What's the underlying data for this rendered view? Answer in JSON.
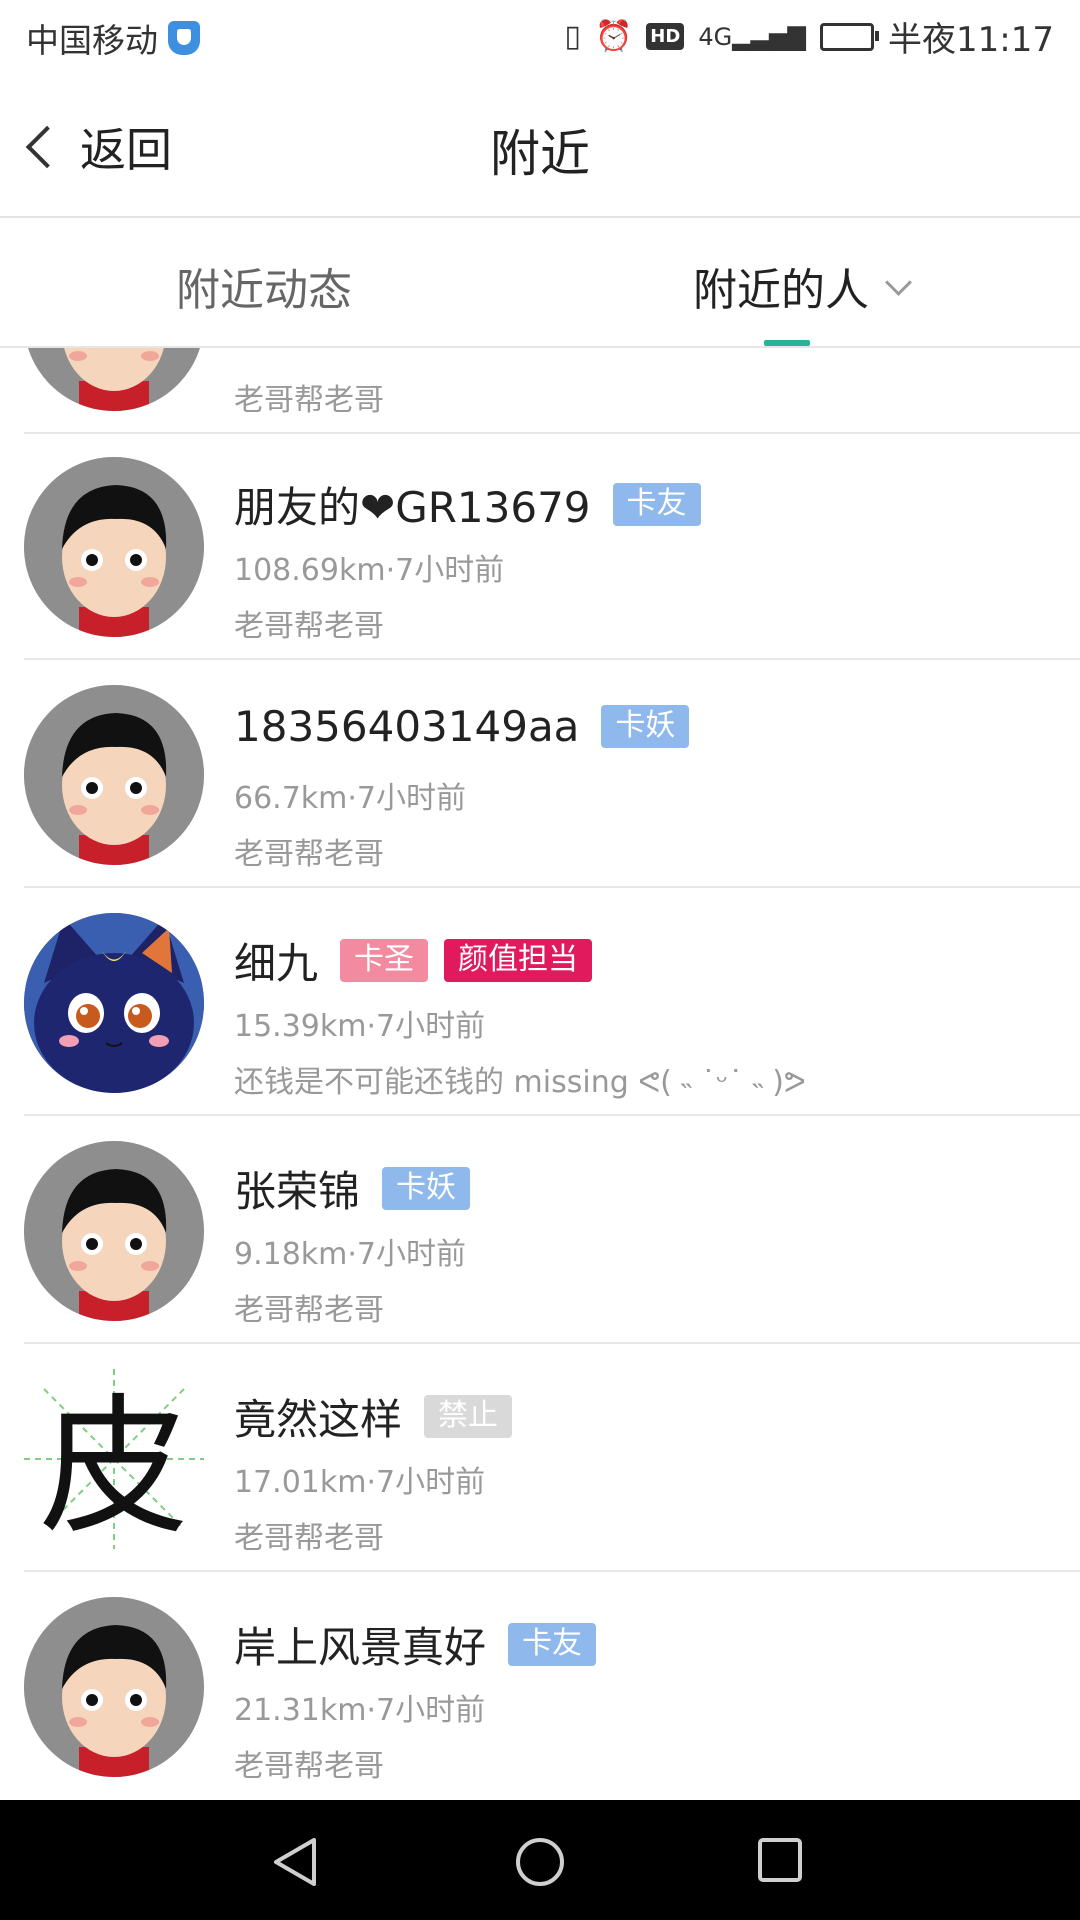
{
  "status_bar": {
    "carrier": "中国移动",
    "hd": "HD",
    "network": "4G",
    "time": "半夜11:17"
  },
  "title_bar": {
    "back_label": "返回",
    "title": "附近"
  },
  "tabs": [
    {
      "label": "附近动态",
      "selected": false
    },
    {
      "label": "附近的人",
      "selected": true
    }
  ],
  "accent_color": "#2bb39a",
  "people": [
    {
      "name": "",
      "badges": [],
      "meta": "",
      "signature": "老哥帮老哥",
      "avatar": "default-avatar"
    },
    {
      "name": "朋友的❤GR13679",
      "badges": [
        {
          "text": "卡友",
          "color": "#8fb8ec"
        }
      ],
      "meta": "108.69km·7小时前",
      "signature": "老哥帮老哥",
      "avatar": "default-avatar"
    },
    {
      "name": "18356403149aa",
      "badges": [
        {
          "text": "卡妖",
          "color": "#8fb8ec"
        }
      ],
      "meta": "66.7km·7小时前",
      "signature": "老哥帮老哥",
      "avatar": "default-avatar"
    },
    {
      "name": "细九",
      "badges": [
        {
          "text": "卡圣",
          "color": "#f28aa0"
        },
        {
          "text": "颜值担当",
          "color": "#e01a5c"
        }
      ],
      "meta": "15.39km·7小时前",
      "signature": "还钱是不可能还钱的 missing ᕙ( ˵ ˙ᵕ˙ ˵ )ᕗ",
      "avatar": "cat-avatar"
    },
    {
      "name": "张荣锦",
      "badges": [
        {
          "text": "卡妖",
          "color": "#8fb8ec"
        }
      ],
      "meta": "9.18km·7小时前",
      "signature": "老哥帮老哥",
      "avatar": "default-avatar"
    },
    {
      "name": "竟然这样",
      "badges": [
        {
          "text": "禁止",
          "color": "#d9d9d9"
        }
      ],
      "meta": "17.01km·7小时前",
      "signature": "老哥帮老哥",
      "avatar": "character-pi-avatar"
    },
    {
      "name": "岸上风景真好",
      "badges": [
        {
          "text": "卡友",
          "color": "#8fb8ec"
        }
      ],
      "meta": "21.31km·7小时前",
      "signature": "老哥帮老哥",
      "avatar": "default-avatar"
    }
  ],
  "pi_character": "皮",
  "nav_bar": {
    "back_icon": "triangle-back-icon",
    "home_icon": "circle-home-icon",
    "recent_icon": "square-recent-icon"
  }
}
